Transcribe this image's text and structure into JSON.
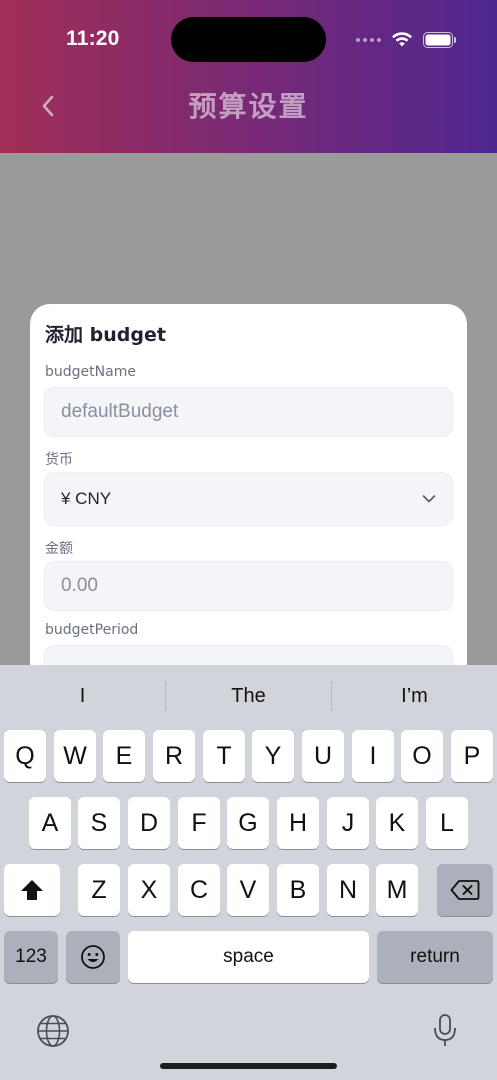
{
  "status": {
    "time": "11:20"
  },
  "header": {
    "title": "预算设置"
  },
  "modal": {
    "title": "添加 budget",
    "fields": {
      "name": {
        "label": "budgetName",
        "placeholder": "defaultBudget"
      },
      "currency": {
        "label": "货币",
        "value": "¥ CNY"
      },
      "amount": {
        "label": "金额",
        "placeholder": "0.00"
      },
      "period": {
        "label": "budgetPeriod"
      }
    }
  },
  "keyboard": {
    "suggestions": [
      "I",
      "The",
      "I’m"
    ],
    "row1": [
      "Q",
      "W",
      "E",
      "R",
      "T",
      "Y",
      "U",
      "I",
      "O",
      "P"
    ],
    "row2": [
      "A",
      "S",
      "D",
      "F",
      "G",
      "H",
      "J",
      "K",
      "L"
    ],
    "row3": [
      "Z",
      "X",
      "C",
      "V",
      "B",
      "N",
      "M"
    ],
    "numbers_label": "123",
    "space_label": "space",
    "return_label": "return"
  },
  "icons": {
    "back": "chevron-left-icon",
    "chevron": "chevron-down-icon",
    "shift": "shift-icon",
    "delete": "delete-icon",
    "emoji": "emoji-icon",
    "globe": "globe-icon",
    "mic": "microphone-icon"
  }
}
